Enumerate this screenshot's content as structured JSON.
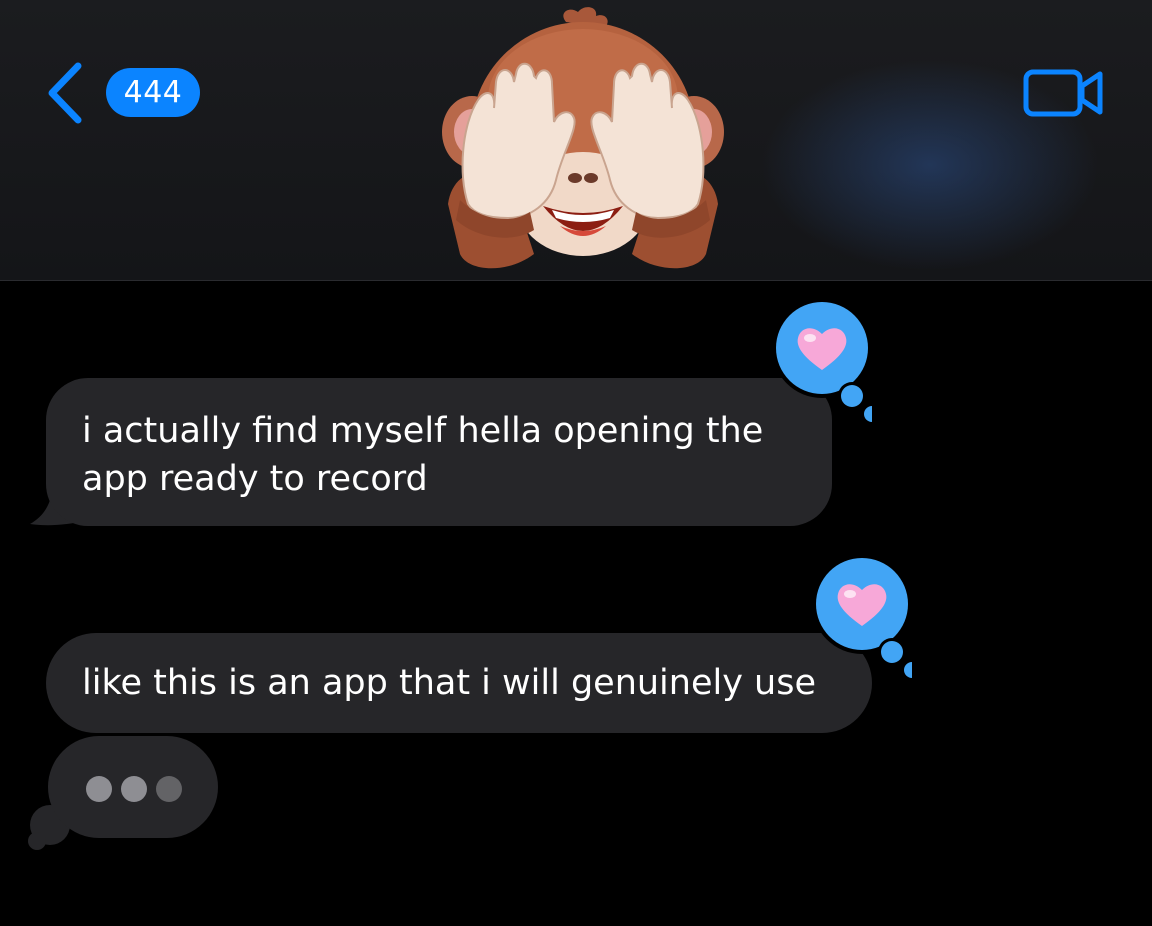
{
  "header": {
    "back_icon": "chevron-left-icon",
    "unread_count": "444",
    "contact_avatar": "monkey-see-no-evil-memoji",
    "video_icon": "video-camera-icon",
    "accent_color": "#0b84ff"
  },
  "messages": [
    {
      "text": "i actually find myself hella opening the app ready to record",
      "direction": "incoming",
      "tapback": "heart"
    },
    {
      "text": "like this is an app that i will genuinely use",
      "direction": "incoming",
      "tapback": "heart"
    }
  ],
  "typing_indicator": {
    "dot_colors": [
      "#8e8e93",
      "#8e8e93",
      "#636366"
    ]
  },
  "colors": {
    "bubble_incoming": "#262629",
    "tapback_bubble": "#42a5f5",
    "heart": "#f7a8d8"
  }
}
